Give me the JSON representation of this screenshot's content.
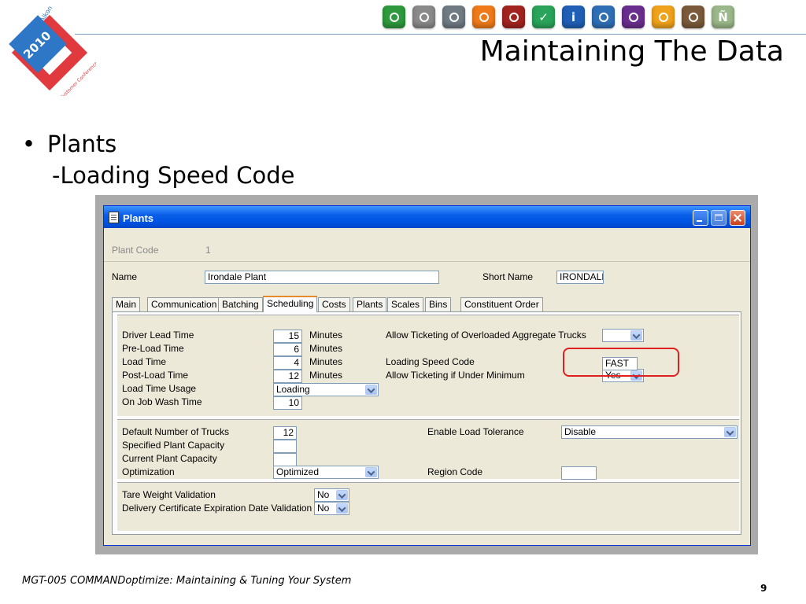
{
  "slide": {
    "title": "Maintaining The Data",
    "bullet": "Plants",
    "sub_bullet": "-Loading Speed Code",
    "footer": "MGT-005 COMMANDoptimize: Maintaining & Tuning Your System",
    "page_number": "9"
  },
  "logo": {
    "arc_text": "Command Alkon",
    "year": "2010",
    "sub_text": "Customer Conference",
    "colors": {
      "red": "#e03a3e",
      "blue": "#2e77c6"
    }
  },
  "toolbar_icons": [
    {
      "name": "flask-icon",
      "color": "#2e9a3e",
      "glyph": ""
    },
    {
      "name": "road-icon",
      "color": "#8a8a8a",
      "glyph": ""
    },
    {
      "name": "globe-icon",
      "color": "#6f7a83",
      "glyph": ""
    },
    {
      "name": "gift-icon",
      "color": "#f07a1a",
      "glyph": ""
    },
    {
      "name": "gears-icon",
      "color": "#a3231f",
      "glyph": ""
    },
    {
      "name": "check-icon",
      "color": "#2aa45a",
      "glyph": "✓"
    },
    {
      "name": "info-icon",
      "color": "#1f5fb5",
      "glyph": "i"
    },
    {
      "name": "dispatch-icon",
      "color": "#2f6fb6",
      "glyph": ""
    },
    {
      "name": "grid-icon",
      "color": "#6a2e8e",
      "glyph": ""
    },
    {
      "name": "document-icon",
      "color": "#f0a21a",
      "glyph": ""
    },
    {
      "name": "truck-icon",
      "color": "#7a5a3a",
      "glyph": ""
    },
    {
      "name": "n-icon",
      "color": "#9bb88a",
      "glyph": "Ñ"
    }
  ],
  "window": {
    "title": "Plants",
    "plant_code_label": "Plant Code",
    "plant_code_value": "1",
    "name_label": "Name",
    "name_value": "Irondale Plant",
    "short_name_label": "Short Name",
    "short_name_value": "IRONDALE",
    "tabs": [
      "Main",
      "Communication",
      "Batching",
      "Scheduling",
      "Costs",
      "Plants",
      "Scales",
      "Bins",
      "Constituent Order"
    ],
    "active_tab": "Scheduling",
    "times": {
      "driver_lead_label": "Driver Lead Time",
      "driver_lead_value": "15",
      "preload_label": "Pre-Load Time",
      "preload_value": "6",
      "load_label": "Load Time",
      "load_value": "4",
      "postload_label": "Post-Load Time",
      "postload_value": "12",
      "unit": "Minutes",
      "usage_label": "Load Time Usage",
      "usage_value": "Loading",
      "wash_label": "On Job Wash Time",
      "wash_value": "10"
    },
    "right_fields": {
      "overloaded_label": "Allow Ticketing of Overloaded Aggregate Trucks",
      "overloaded_value": "",
      "speed_code_label": "Loading Speed Code",
      "speed_code_value": "FAST",
      "under_min_label": "Allow Ticketing if Under Minimum",
      "under_min_value": "Yes"
    },
    "capacity": {
      "trucks_label": "Default Number of Trucks",
      "trucks_value": "12",
      "specified_label": "Specified Plant Capacity",
      "specified_value": "",
      "current_label": "Current Plant Capacity",
      "current_value": "",
      "optimization_label": "Optimization",
      "optimization_value": "Optimized",
      "tolerance_label": "Enable Load Tolerance",
      "tolerance_value": "Disable",
      "region_label": "Region Code",
      "region_value": ""
    },
    "validation": {
      "tare_label": "Tare Weight Validation",
      "tare_value": "No",
      "cert_label": "Delivery Certificate Expiration Date Validation",
      "cert_value": "No"
    }
  }
}
